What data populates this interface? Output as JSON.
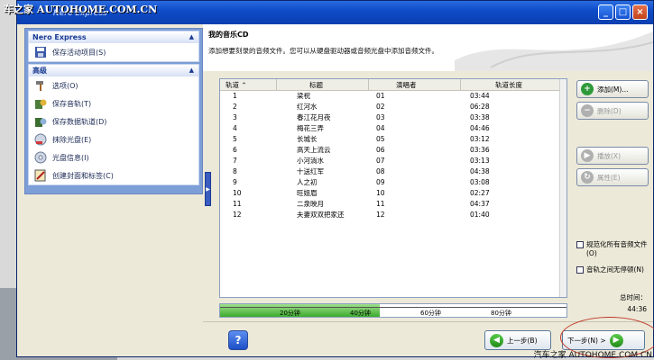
{
  "watermark_top": "车之家 AUTOHOME.COM.CN",
  "watermark_bottom": "汽车之家 AUTOHOME.COM.CN",
  "window": {
    "title": "Nero Express"
  },
  "sidebar": {
    "nero_panel": {
      "title": "Nero Express",
      "items": [
        {
          "label": "保存活动项目(S)",
          "icon": "save-icon"
        }
      ]
    },
    "advanced_panel": {
      "title": "高级",
      "items": [
        {
          "label": "选项(O)",
          "icon": "hammer-icon"
        },
        {
          "label": "保存音轨(T)",
          "icon": "save-audio-icon"
        },
        {
          "label": "保存数据轨道(D)",
          "icon": "save-data-track-icon"
        },
        {
          "label": "抹除光盘(E)",
          "icon": "erase-disc-icon"
        },
        {
          "label": "光盘信息(I)",
          "icon": "disc-info-icon"
        },
        {
          "label": "创建封面和标签(C)",
          "icon": "cover-label-icon"
        }
      ]
    }
  },
  "header": {
    "title": "我的音乐CD",
    "description": "添加想要刻录的音频文件。您可以从硬盘驱动器或音频光盘中添加音频文件。"
  },
  "track_table": {
    "columns": [
      "轨道",
      "标题",
      "演唱者",
      "轨道长度"
    ],
    "rows": [
      {
        "track": "1",
        "title": "梁祝",
        "artist": "01",
        "length": "03:44"
      },
      {
        "track": "2",
        "title": "红河水",
        "artist": "02",
        "length": "06:28"
      },
      {
        "track": "3",
        "title": "春江花月夜",
        "artist": "03",
        "length": "03:38"
      },
      {
        "track": "4",
        "title": "梅花三弄",
        "artist": "04",
        "length": "04:46"
      },
      {
        "track": "5",
        "title": "长城长",
        "artist": "05",
        "length": "03:12"
      },
      {
        "track": "6",
        "title": "高天上流云",
        "artist": "06",
        "length": "03:36"
      },
      {
        "track": "7",
        "title": "小河淌水",
        "artist": "07",
        "length": "03:13"
      },
      {
        "track": "8",
        "title": "十送红军",
        "artist": "08",
        "length": "04:38"
      },
      {
        "track": "9",
        "title": "人之初",
        "artist": "09",
        "length": "03:08"
      },
      {
        "track": "10",
        "title": "旺姐眉",
        "artist": "10",
        "length": "02:27"
      },
      {
        "track": "11",
        "title": "二泉映月",
        "artist": "11",
        "length": "04:37"
      },
      {
        "track": "12",
        "title": "夫妻双双把家还",
        "artist": "12",
        "length": "01:40"
      }
    ]
  },
  "capacity_meter": {
    "fill_fraction": 0.46,
    "labels": [
      "20分钟",
      "40分钟",
      "60分钟",
      "80分钟"
    ]
  },
  "actions": {
    "add": "添加(M)...",
    "delete": "删除(D)",
    "play": "播放(X)",
    "properties": "属性(E)"
  },
  "options": {
    "normalize": "规范化所有音频文件(O)",
    "no_pause": "音轨之间无停顿(N)"
  },
  "total": {
    "label": "总时间：",
    "value": "44:36"
  },
  "nav": {
    "back": "上一步(B)",
    "next": "下一步(N) >"
  }
}
